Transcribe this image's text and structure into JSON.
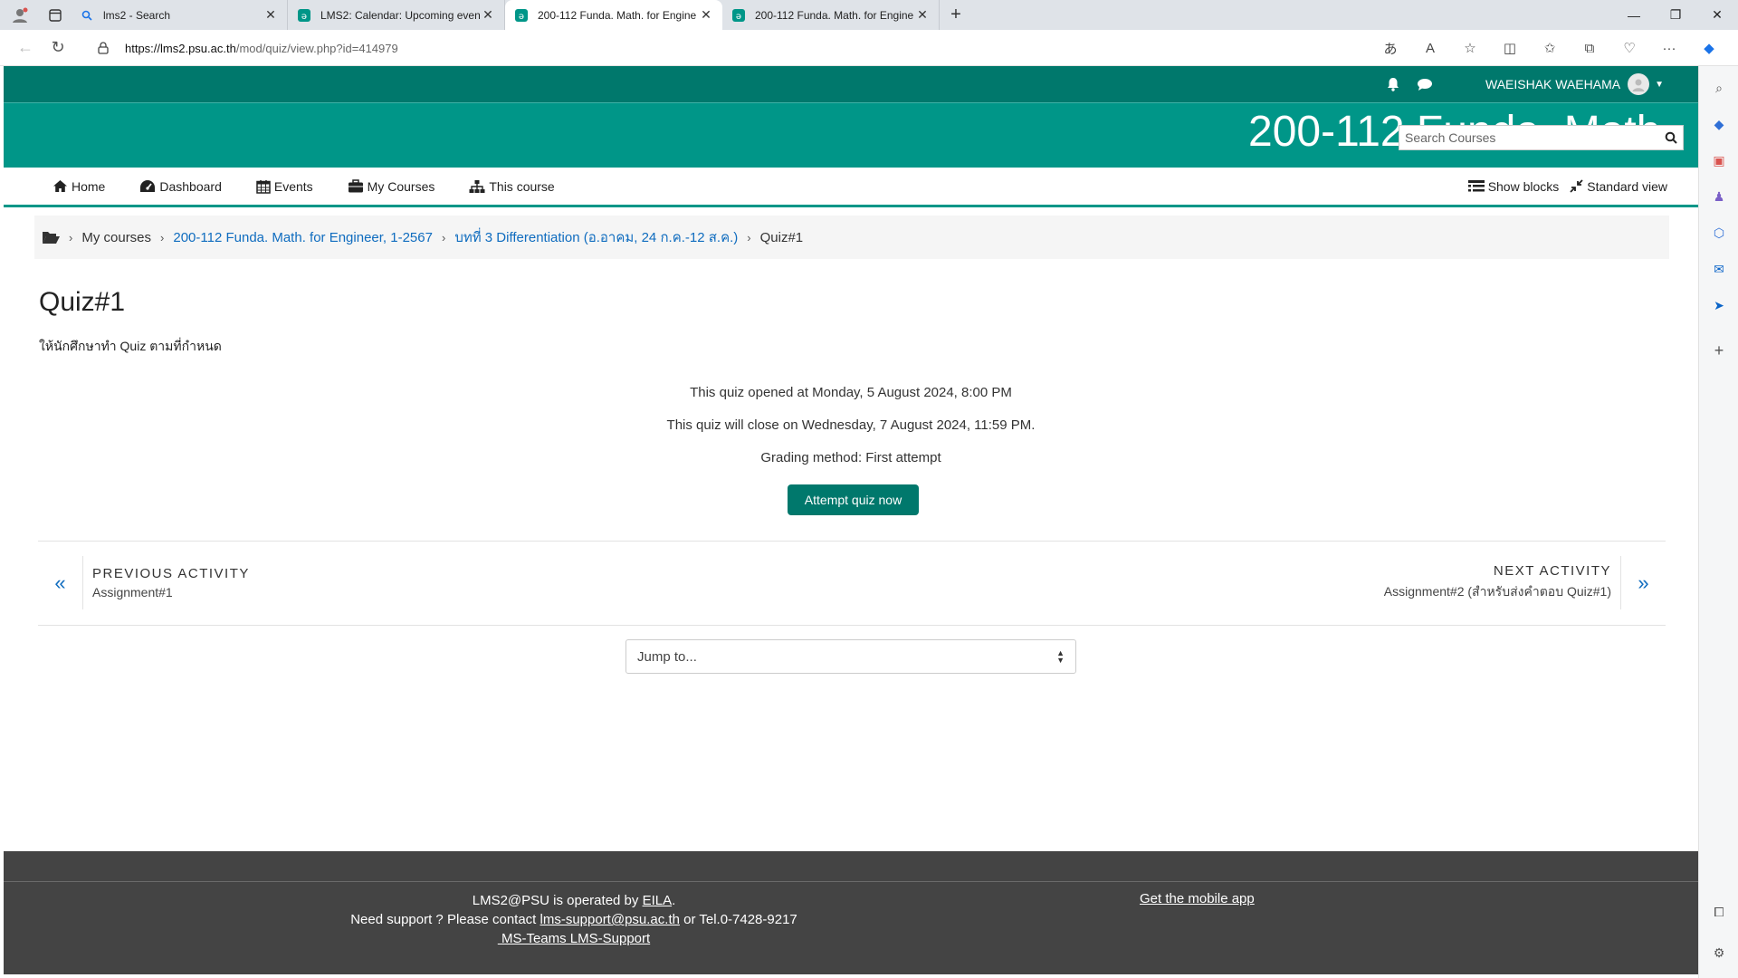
{
  "browser": {
    "tabs": [
      {
        "title": "lms2 - Search",
        "favicon": "search-icon"
      },
      {
        "title": "LMS2: Calendar: Upcoming even",
        "favicon": "moodle-icon"
      },
      {
        "title": "200-112 Funda. Math. for Engine",
        "favicon": "moodle-icon",
        "active": true
      },
      {
        "title": "200-112 Funda. Math. for Engine",
        "favicon": "moodle-icon"
      }
    ],
    "url_host": "https://lms2.psu.ac.th",
    "url_path": "/mod/quiz/view.php?id=414979"
  },
  "header": {
    "user_name": "WAEISHAK WAEHAMA",
    "banner_title": "200-112 Funda. Math",
    "search_placeholder": "Search Courses"
  },
  "mainnav": {
    "home": "Home",
    "dashboard": "Dashboard",
    "events": "Events",
    "my_courses": "My Courses",
    "this_course": "This course",
    "show_blocks": "Show blocks",
    "standard_view": "Standard view"
  },
  "breadcrumb": {
    "my_courses": "My courses",
    "course": "200-112 Funda. Math. for Engineer, 1-2567",
    "section": "บทที่ 3 Differentiation (อ.อาคม, 24 ก.ค.-12 ส.ค.)",
    "current": "Quiz#1"
  },
  "quiz": {
    "title": "Quiz#1",
    "description": "ให้นักศึกษาทำ Quiz ตามที่กำหนด",
    "opened": "This quiz opened at Monday, 5 August 2024, 8:00 PM",
    "closes": "This quiz will close on Wednesday, 7 August 2024, 11:59 PM.",
    "grading": "Grading method: First attempt",
    "attempt_button": "Attempt quiz now"
  },
  "activity_nav": {
    "prev_label": "PREVIOUS ACTIVITY",
    "prev_name": "Assignment#1",
    "next_label": "NEXT ACTIVITY",
    "next_name": "Assignment#2 (สำหรับส่งคำตอบ Quiz#1)",
    "jump_to": "Jump to..."
  },
  "footer": {
    "operated_prefix": "LMS2@PSU is operated by ",
    "operator": "EILA",
    "operated_suffix": ".",
    "support_prefix": "Need support ? Please contact ",
    "support_email": "lms-support@psu.ac.th",
    "support_suffix": " or Tel.0-7428-9217",
    "teams": " MS-Teams LMS-Support",
    "mobile_app": "Get the mobile app"
  },
  "colors": {
    "topbar": "#00786c",
    "banner": "#009688",
    "link": "#0f6cbf",
    "footer": "#444444"
  }
}
